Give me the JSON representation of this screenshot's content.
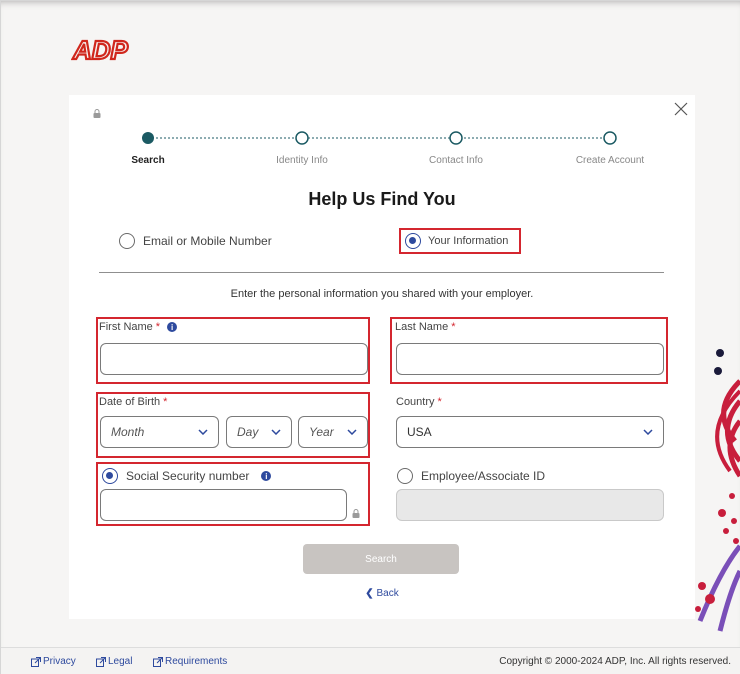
{
  "brand": {
    "logo_text": "ADP",
    "color": "#d0271d"
  },
  "steps": [
    {
      "label": "Search",
      "active": true
    },
    {
      "label": "Identity Info",
      "active": false
    },
    {
      "label": "Contact Info",
      "active": false
    },
    {
      "label": "Create Account",
      "active": false
    }
  ],
  "title": "Help Us Find You",
  "mode": {
    "option1": "Email or Mobile Number",
    "option2": "Your Information",
    "selected": "Your Information"
  },
  "intro": "Enter the personal information you shared with your employer.",
  "fields": {
    "first_name": {
      "label": "First Name",
      "required": "*",
      "value": ""
    },
    "last_name": {
      "label": "Last Name",
      "required": "*",
      "value": ""
    },
    "dob": {
      "label": "Date of Birth",
      "required": "*",
      "month": "Month",
      "day": "Day",
      "year": "Year"
    },
    "country": {
      "label": "Country",
      "required": "*",
      "value": "USA"
    },
    "ssn": {
      "label": "Social Security number",
      "value": ""
    },
    "employee_id": {
      "label": "Employee/Associate ID",
      "value": ""
    }
  },
  "search_button": "Search",
  "back_link": "Back",
  "footer": {
    "links": [
      "Privacy",
      "Legal",
      "Requirements"
    ],
    "copyright": "Copyright © 2000-2024 ADP, Inc. All rights reserved."
  },
  "colors": {
    "accent": "#2e4a9e",
    "highlight": "#d4262f",
    "stepper": "#1b5a63"
  }
}
